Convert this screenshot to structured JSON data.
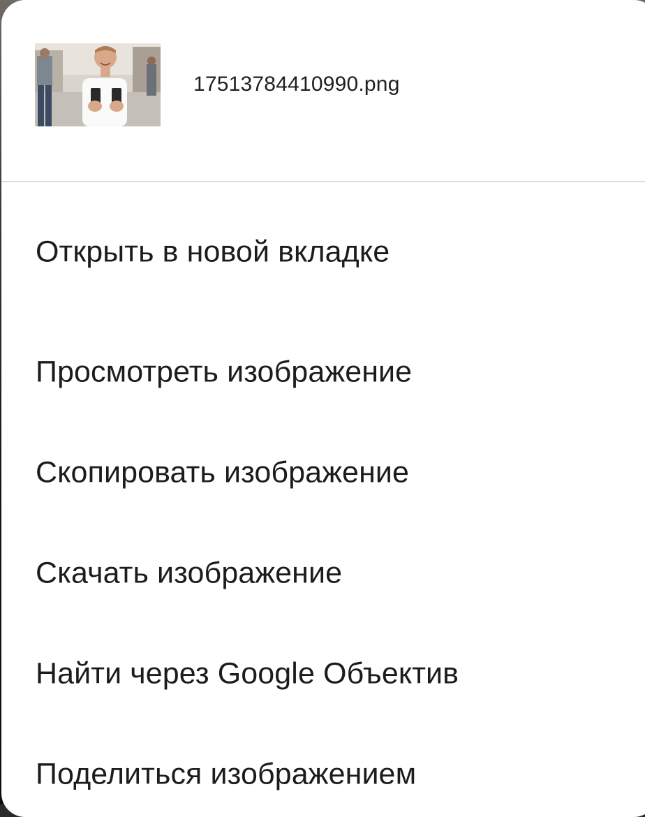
{
  "header": {
    "filename": "17513784410990.png",
    "thumbnail_icon": "image-thumbnail"
  },
  "menu": {
    "items": [
      {
        "label": "Открыть в новой вкладке"
      },
      {
        "label": "Просмотреть изображение"
      },
      {
        "label": "Скопировать изображение"
      },
      {
        "label": "Скачать изображение"
      },
      {
        "label": "Найти через Google Объектив"
      },
      {
        "label": "Поделиться изображением"
      }
    ]
  },
  "colors": {
    "sheet_background": "#ffffff",
    "text": "#1c1c1c",
    "divider": "#dcdcdc"
  }
}
